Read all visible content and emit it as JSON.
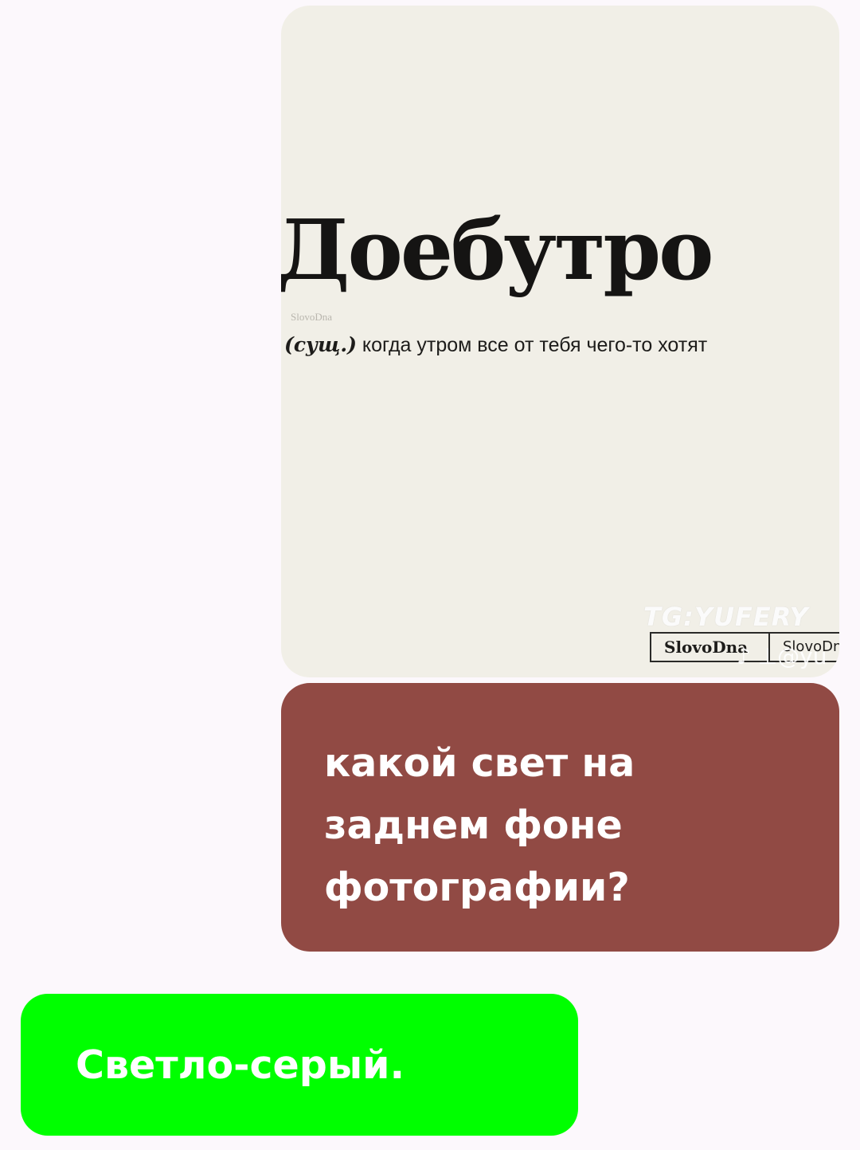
{
  "chat": {
    "image_message": {
      "title": "Доебутро",
      "small_brand": "SlovoDna",
      "part_of_speech": "(сущ.)",
      "definition": " когда утром все от тебя чего-то хотят",
      "watermark_tg": "TG:YUFERY",
      "logo_primary": "SlovoDna",
      "logo_secondary": "SlovoDn",
      "tiktok_mark": "♪ ⊥@yu"
    },
    "question_message": {
      "text": "какой свет на заднем фоне фотографии?"
    },
    "answer_message": {
      "text": "Светло-серый."
    }
  },
  "colors": {
    "page_background": "#fcf8fc",
    "image_background": "#f1efe7",
    "question_bubble": "#914a44",
    "answer_bubble": "#00ff00",
    "bubble_text": "#ffffff"
  }
}
